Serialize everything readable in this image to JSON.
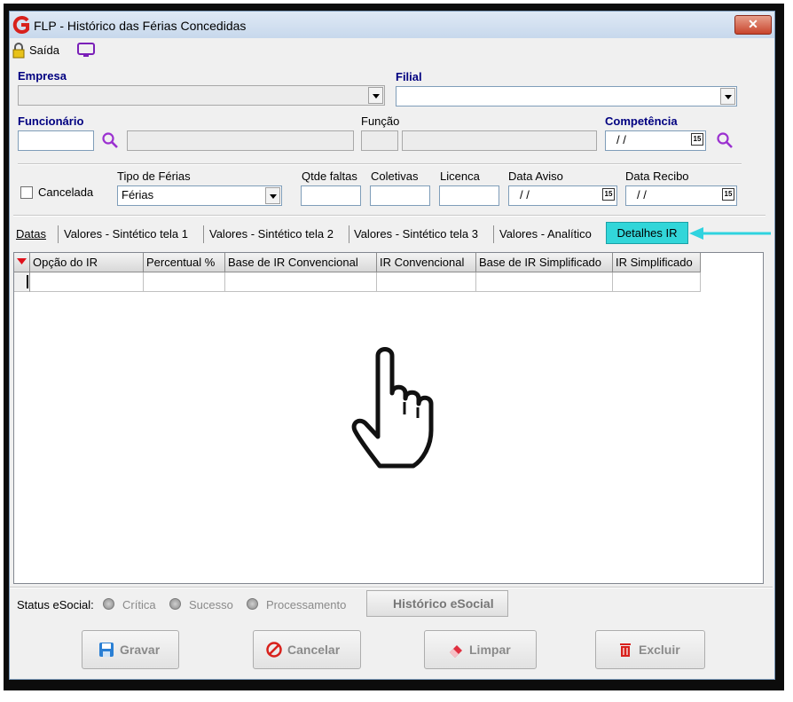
{
  "window": {
    "title": "FLP - Histórico das Férias Concedidas",
    "close_label": "✕"
  },
  "toolbar": {
    "exit_label": "Saída"
  },
  "form": {
    "empresa_label": "Empresa",
    "filial_label": "Filial",
    "funcionario_label": "Funcionário",
    "funcao_label": "Função",
    "competencia_label": "Competência",
    "competencia_value": "/ /",
    "cancelada_label": "Cancelada",
    "tipo_ferias_label": "Tipo de Férias",
    "tipo_ferias_value": "Férias",
    "qtde_faltas_label": "Qtde faltas",
    "coletivas_label": "Coletivas",
    "licenca_label": "Licenca",
    "data_aviso_label": "Data Aviso",
    "data_aviso_value": "/ /",
    "data_recibo_label": "Data Recibo",
    "data_recibo_value": "/ /",
    "calendar_glyph": "15"
  },
  "tabs": {
    "datas": "Datas",
    "sint1": "Valores - Sintético tela 1",
    "sint2": "Valores - Sintético tela 2",
    "sint3": "Valores - Sintético tela 3",
    "analitico": "Valores - Analítico",
    "detalhes_ir": "Detalhes IR"
  },
  "grid": {
    "columns": [
      "Opção do IR",
      "Percentual %",
      "Base de IR Convencional",
      "IR Convencional",
      "Base de IR Simplificado",
      "IR Simplificado"
    ]
  },
  "status": {
    "label": "Status eSocial:",
    "critica": "Crítica",
    "sucesso": "Sucesso",
    "processamento": "Processamento",
    "historico_button": "Histórico eSocial"
  },
  "buttons": {
    "gravar": "Gravar",
    "cancelar": "Cancelar",
    "limpar": "Limpar",
    "excluir": "Excluir"
  },
  "colors": {
    "accent_tab": "#32d6d9",
    "arrow": "#2fd3df",
    "label_blue": "#000080"
  }
}
